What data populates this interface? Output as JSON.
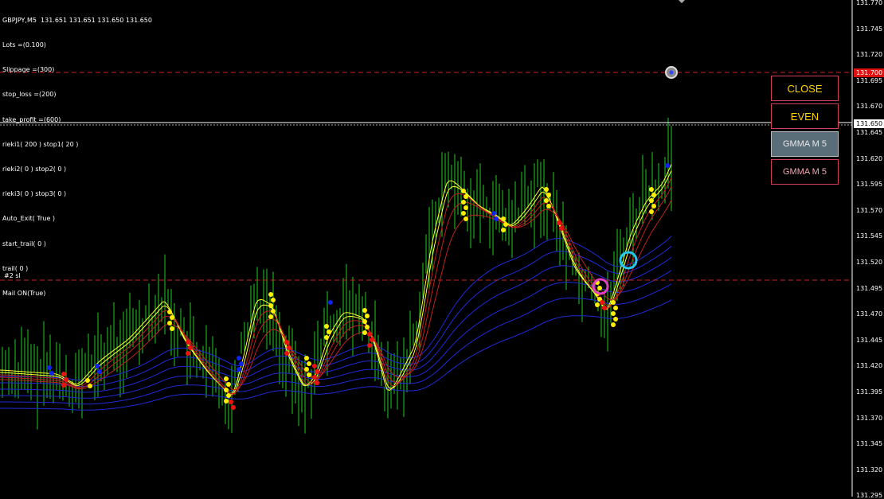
{
  "symbol_line": "GBPJPY,M5  131.651 131.651 131.650 131.650",
  "info_lines": [
    "Lots =(0.100)",
    "Slippage =(300)",
    "stop_loss =(200)",
    "take_profit =(600)",
    "rieki1( 200 ) stop1( 20 )",
    "rieki2( 0 ) stop2( 0 )",
    "rieki3( 0 ) stop3( 0 )",
    "Auto_Exit( True )",
    "start_trail( 0 )",
    "trail( 0 )",
    "Mail ON(True)"
  ],
  "buttons": {
    "close": "CLOSE",
    "even": "EVEN",
    "gmma1": "GMMA M 5",
    "gmma2": "GMMA M 5"
  },
  "sl_label": "#2 sl",
  "price_axis": [
    "131.770",
    "131.745",
    "131.720",
    "131.695",
    "131.670",
    "131.645",
    "131.620",
    "131.595",
    "131.570",
    "131.545",
    "131.520",
    "131.495",
    "131.470",
    "131.445",
    "131.420",
    "131.395",
    "131.370",
    "131.345",
    "131.320",
    "131.295"
  ],
  "current_price_tag": "131.650",
  "order_price_tag": "131.700",
  "colors": {
    "background": "#000000",
    "candles": "#22cc22",
    "short_ema": "#ffff33",
    "long_ema": "#1e2bd9",
    "dot_yellow": "#ffee00",
    "dot_red": "#ee1111",
    "dot_blue": "#1122ee",
    "sl_line": "#cc2222",
    "price_line": "#ffffff"
  }
}
